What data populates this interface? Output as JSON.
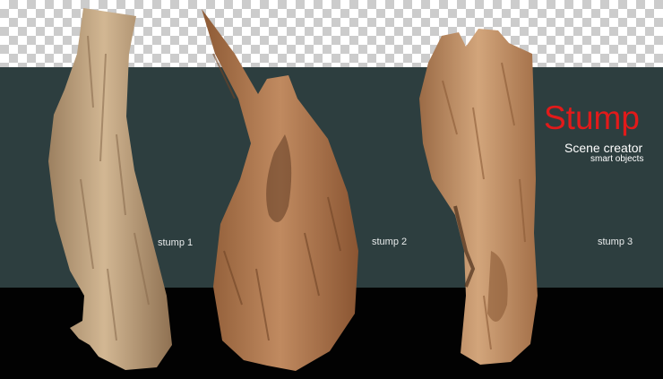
{
  "scene": {
    "title": "Stump",
    "subtitle": "Scene creator",
    "tagline": "smart objects"
  },
  "stumps": [
    {
      "label": "stump 1",
      "icon": "wood-stump-tall-curved"
    },
    {
      "label": "stump 2",
      "icon": "wood-stump-split-hollow"
    },
    {
      "label": "stump 3",
      "icon": "wood-stump-broken-top"
    }
  ],
  "colors": {
    "title": "#e21a1a",
    "background_teal": "#2d3e3f",
    "background_black": "#020202",
    "checker_dark": "#cccccc",
    "wood_light": "#c9a47c",
    "wood_mid": "#a9744c",
    "wood_dark": "#7a4a2a"
  }
}
